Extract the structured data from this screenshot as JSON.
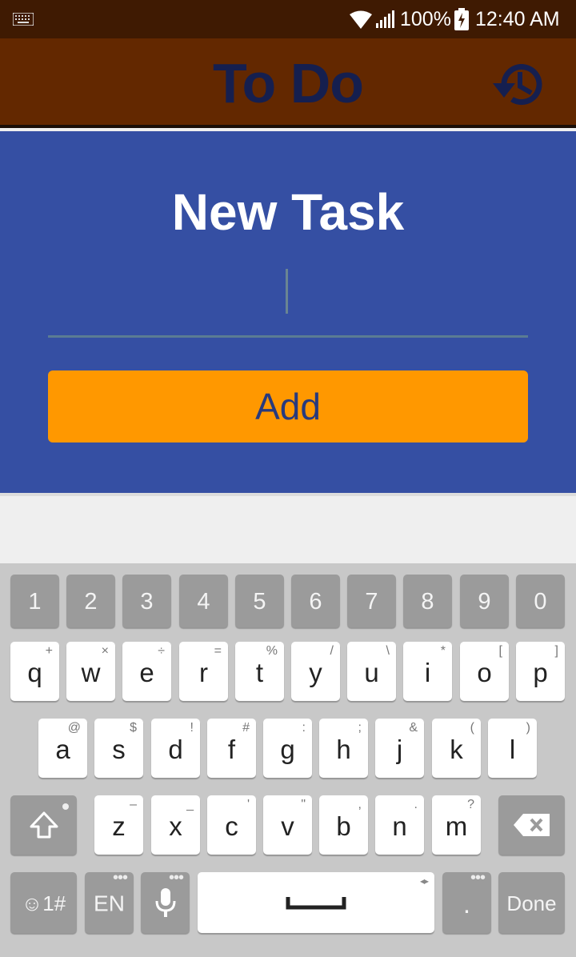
{
  "status_bar": {
    "battery": "100%",
    "time": "12:40 AM",
    "icons": [
      "keyboard-icon",
      "wifi-icon",
      "signal-icon",
      "battery-charging-icon"
    ]
  },
  "app_bar": {
    "title": "To Do",
    "history_icon": "history-icon"
  },
  "form": {
    "title": "New Task",
    "input_value": "",
    "add_label": "Add"
  },
  "keyboard": {
    "number_row": [
      "1",
      "2",
      "3",
      "4",
      "5",
      "6",
      "7",
      "8",
      "9",
      "0"
    ],
    "row1": {
      "keys": [
        "q",
        "w",
        "e",
        "r",
        "t",
        "y",
        "u",
        "i",
        "o",
        "p"
      ],
      "subs": [
        "+",
        "×",
        "÷",
        "=",
        "%",
        "/",
        "\\",
        "*",
        "[",
        "]"
      ]
    },
    "row2": {
      "keys": [
        "a",
        "s",
        "d",
        "f",
        "g",
        "h",
        "j",
        "k",
        "l"
      ],
      "subs": [
        "@",
        "$",
        "!",
        "#",
        ":",
        ";",
        "&",
        "(",
        ")"
      ]
    },
    "row3": {
      "keys": [
        "z",
        "x",
        "c",
        "v",
        "b",
        "n",
        "m"
      ],
      "subs": [
        "–",
        "_",
        "'",
        "\"",
        ",",
        ".",
        "?"
      ]
    },
    "bottom": {
      "symbols_label": "☺1#",
      "language_label": "EN",
      "period_label": ".",
      "done_label": "Done"
    },
    "colors": {
      "key_bg": "#ffffff",
      "gray_key_bg": "#9b9b9b",
      "keyboard_bg": "#c8c8c8"
    }
  },
  "colors": {
    "status_bar": "#3f1a02",
    "app_bar": "#632800",
    "title_text": "#151f4f",
    "panel": "#354fa3",
    "add_button": "#ff9800",
    "add_text": "#283a7d"
  }
}
